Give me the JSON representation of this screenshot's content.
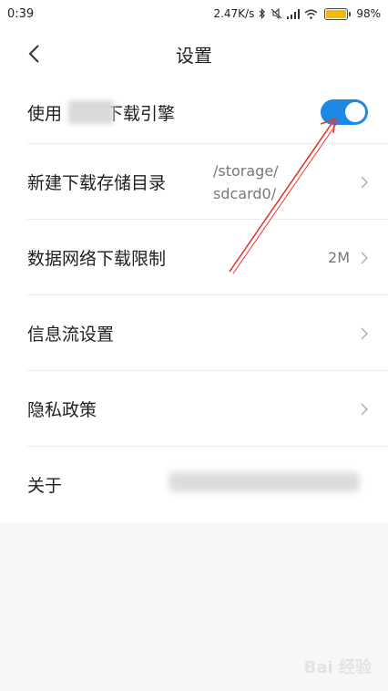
{
  "status_bar": {
    "time": "0:39",
    "speed": "2.47K/s",
    "battery_percent": "98%",
    "battery_level": 0.98
  },
  "header": {
    "title": "设置"
  },
  "settings": {
    "use_engine_prefix": "使用",
    "use_engine_suffix": "下载引擎",
    "use_engine_on": true,
    "storage_label": "新建下载存储目录",
    "storage_value": "/storage/\nsdcard0/",
    "data_limit_label": "数据网络下载限制",
    "data_limit_value": "2M",
    "feed_label": "信息流设置",
    "privacy_label": "隐私政策",
    "about_label": "关于"
  },
  "colors": {
    "accent": "#1e88e5",
    "annotation": "#e53935"
  },
  "watermark": "Bai 经验"
}
